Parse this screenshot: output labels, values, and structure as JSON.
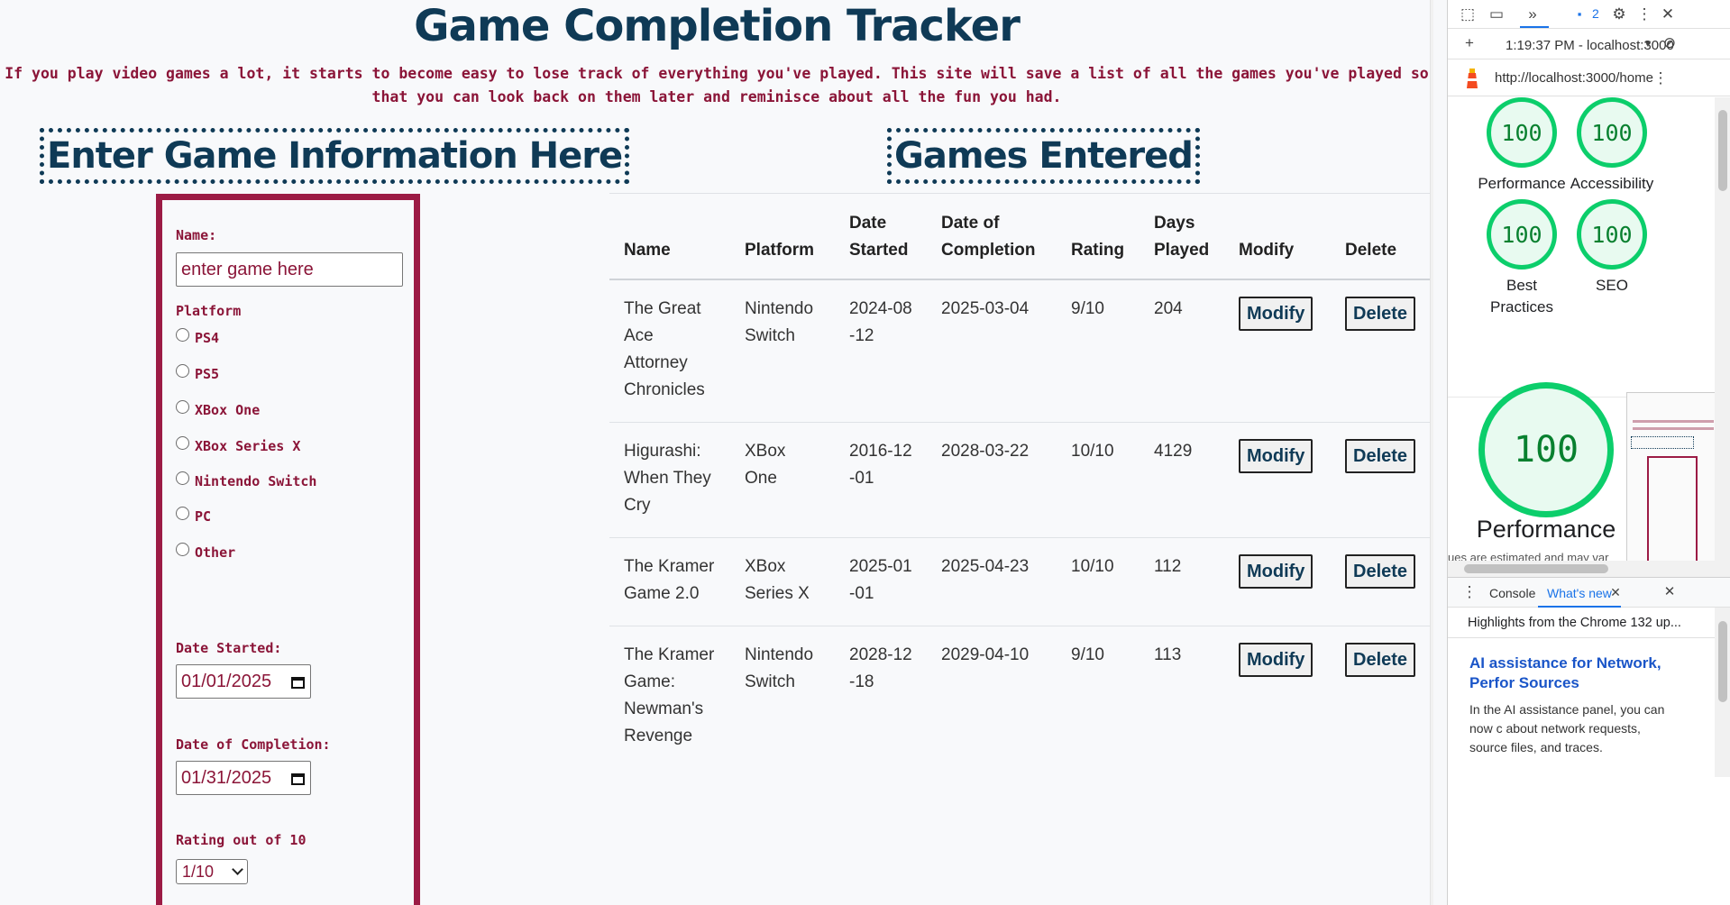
{
  "header": {
    "title": "Game Completion Tracker",
    "intro": "If you play video games a lot, it starts to become easy to lose track of everything you've played. This site will save a list of all the games you've played so that you can look back on them later and reminisce about all the fun you had."
  },
  "form": {
    "heading": "Enter Game Information Here",
    "name_label": "Name:",
    "name_placeholder": "enter game here",
    "platform_label": "Platform",
    "platforms": [
      "PS4",
      "PS5",
      "XBox One",
      "XBox Series X",
      "Nintendo Switch",
      "PC",
      "Other"
    ],
    "date_started_label": "Date Started:",
    "date_started_value": "01/01/2025",
    "date_completed_label": "Date of Completion:",
    "date_completed_value": "01/31/2025",
    "rating_label": "Rating out of 10",
    "rating_value": "1/10"
  },
  "games": {
    "heading": "Games Entered",
    "columns": [
      "Name",
      "Platform",
      "Date Started",
      "Date of Completion",
      "Rating",
      "Days Played",
      "Modify",
      "Delete"
    ],
    "rows": [
      {
        "name": "The Great Ace Attorney Chronicles",
        "platform": "Nintendo Switch",
        "date_started": "2024-08-12",
        "date_completed": "2025-03-04",
        "rating": "9/10",
        "days": "204"
      },
      {
        "name": "Higurashi: When They Cry",
        "platform": "XBox One",
        "date_started": "2016-12-01",
        "date_completed": "2028-03-22",
        "rating": "10/10",
        "days": "4129"
      },
      {
        "name": "The Kramer Game 2.0",
        "platform": "XBox Series X",
        "date_started": "2025-01-01",
        "date_completed": "2025-04-23",
        "rating": "10/10",
        "days": "112"
      },
      {
        "name": "The Kramer Game: Newman's Revenge",
        "platform": "Nintendo Switch",
        "date_started": "2028-12-18",
        "date_completed": "2029-04-10",
        "rating": "9/10",
        "days": "113"
      }
    ],
    "modify_label": "Modify",
    "delete_label": "Delete"
  },
  "devtools": {
    "message_count": "2",
    "lighthouse_time": "1:19:37 PM - localhost:3000",
    "url": "http://localhost:3000/home",
    "scores": [
      {
        "label": "Performance",
        "score": "100"
      },
      {
        "label": "Accessibility",
        "score": "100"
      },
      {
        "label": "Best Practices",
        "score": "100"
      },
      {
        "label": "SEO",
        "score": "100"
      }
    ],
    "big_score": "100",
    "big_label": "Performance",
    "note": "ues are estimated and may var",
    "drawer_tabs": [
      "Console",
      "What's new"
    ],
    "drawer_highlights": "Highlights from the Chrome 132 up...",
    "drawer_link": "AI assistance for Network, Perfor Sources",
    "drawer_text": "In the AI assistance panel, you can now c about network requests, source files, and traces."
  },
  "colors": {
    "title": "#0f3a56",
    "accent": "#8b1538",
    "form_border": "#9c1b45",
    "score_green": "#0cce6b"
  }
}
